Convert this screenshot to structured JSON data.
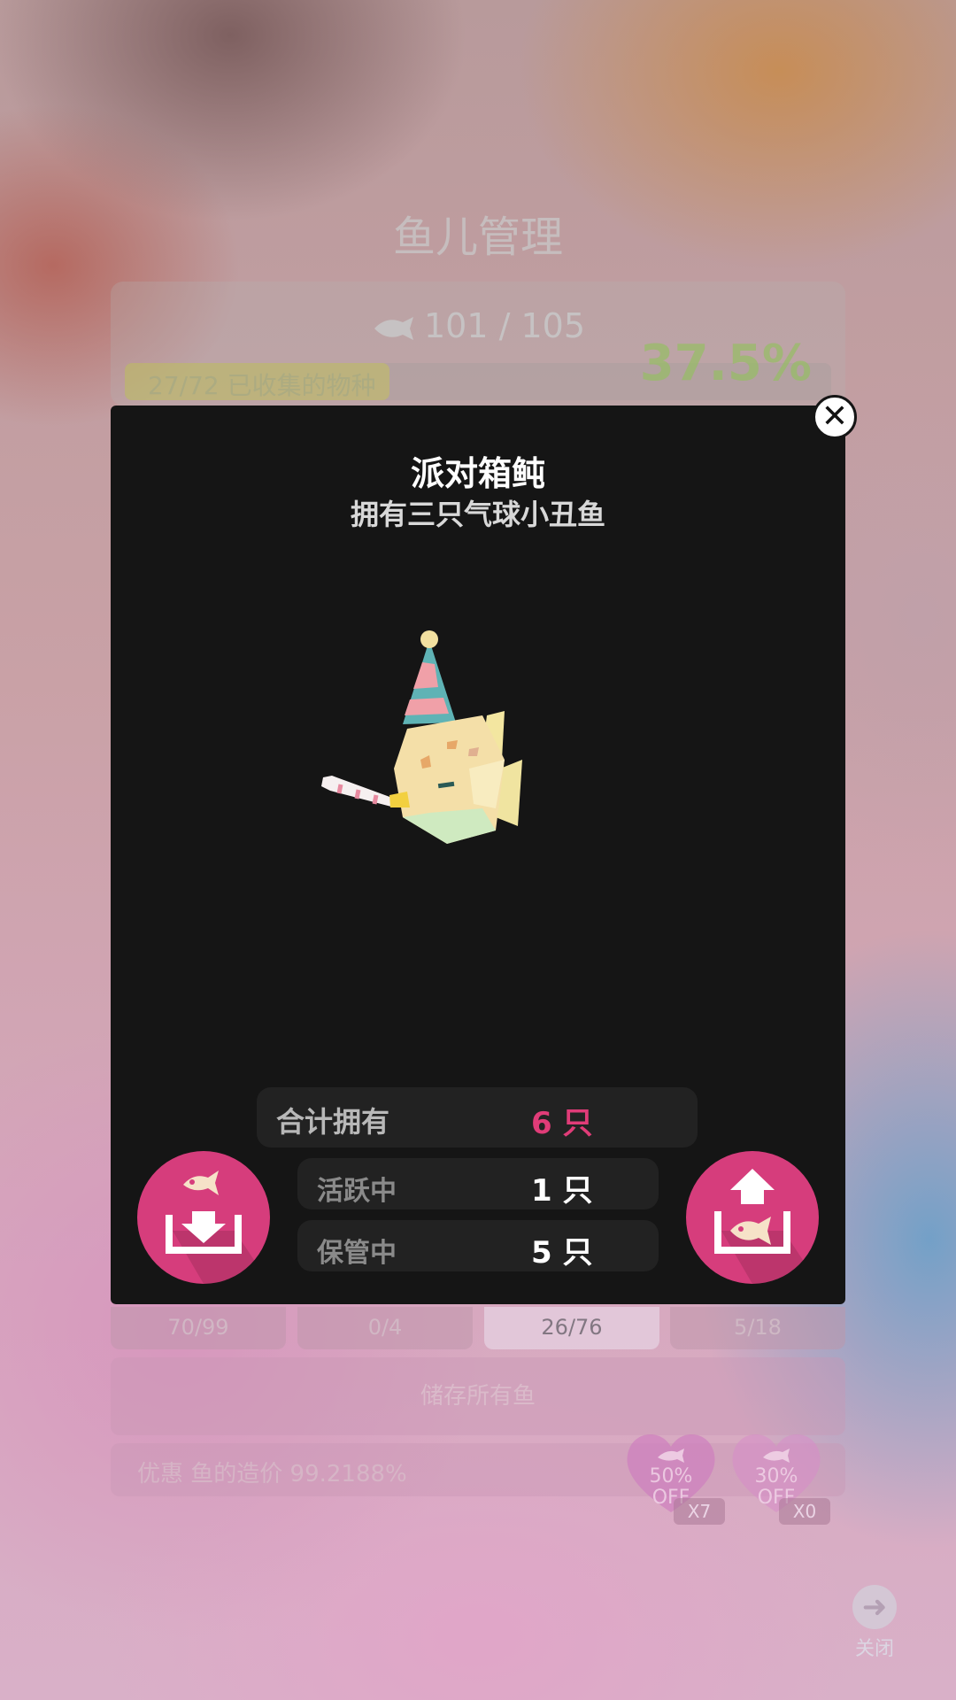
{
  "background": {
    "title": "鱼儿管理",
    "fish_count": "101 / 105",
    "species_collected": "27/72 已收集的物种",
    "species_percent": "37.5%",
    "species_progress": 0.375,
    "tabs": [
      "70/99",
      "0/4",
      "26/76",
      "5/18"
    ],
    "active_tab_index": 2,
    "store_all_label": "储存所有鱼",
    "discount_label": "优惠 鱼的造价 99.2188%",
    "coupons": [
      {
        "line1": "50%",
        "line2": "OFF",
        "count": "X7"
      },
      {
        "line1": "30%",
        "line2": "OFF",
        "count": "X0"
      }
    ],
    "close_label": "关闭"
  },
  "modal": {
    "close_icon": "close-icon",
    "fish_name": "派对箱鲀",
    "fish_desc": "拥有三只气球小丑鱼",
    "total": {
      "label": "合计拥有",
      "value": "6 只"
    },
    "active": {
      "label": "活跃中",
      "value": "1 只"
    },
    "stored": {
      "label": "保管中",
      "value": "5 只"
    },
    "store_button_icon": "fish-store-icon",
    "release_button_icon": "fish-release-icon"
  },
  "colors": {
    "accent": "#d63d7c",
    "total_value": "#e03c78",
    "modal_bg": "#151515"
  }
}
